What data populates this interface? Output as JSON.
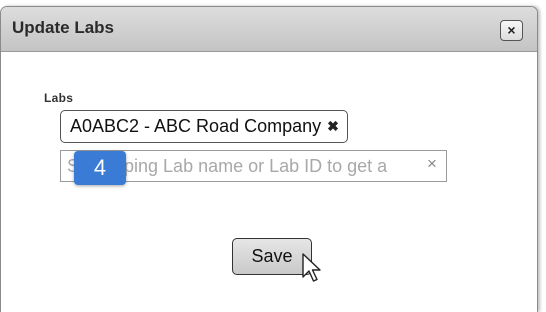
{
  "dialog": {
    "title": "Update Labs",
    "close_label": "×"
  },
  "labs": {
    "label": "Labs",
    "selected": [
      {
        "text": "A0ABC2 - ABC Road Company",
        "remove": "✖"
      }
    ],
    "search_value": "",
    "search_placeholder": "Start typing Lab name or Lab ID to get a",
    "clear_icon": "×"
  },
  "step_badge": "4",
  "save_label": "Save",
  "colors": {
    "badge": "#3a7bd5",
    "titlebar": "#c4c4c4"
  }
}
